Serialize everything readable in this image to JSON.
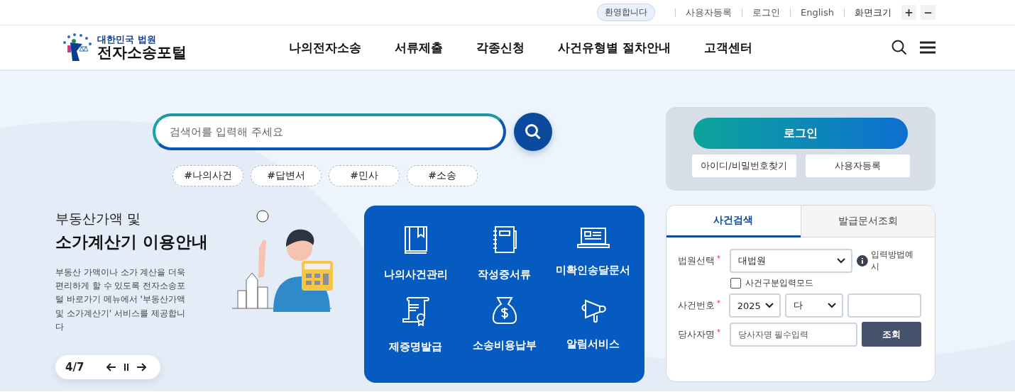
{
  "utility_bar": {
    "welcome": "환영합니다",
    "links": [
      "사용자등록",
      "로그인",
      "English"
    ],
    "font_size_label": "화면크기",
    "font_size_buttons": [
      "+",
      "−"
    ]
  },
  "logo": {
    "subtitle": "대한민국 법원",
    "title": "전자소송포털"
  },
  "nav": {
    "items": [
      "나의전자소송",
      "서류제출",
      "각종신청",
      "사건유형별 절차안내",
      "고객센터"
    ]
  },
  "search": {
    "placeholder": "검색어를 입력해 주세요",
    "tags": [
      "#나의사건",
      "#답변서",
      "#민사",
      "#소송"
    ]
  },
  "promo": {
    "title_line1": "부동산가액 및",
    "title_line2": "소가계산기 이용안내",
    "body": "부동산 가액이나 소가 계산을 더욱 편리하게 할 수 있도록 전자소송포털 바로가기 메뉴에서 '부동산가액 및 소가계산기' 서비스를 제공합니다",
    "pager": "4/7",
    "paused": false
  },
  "quick_menu": {
    "items": [
      "나의사건관리",
      "작성중서류",
      "미확인송달문서",
      "제증명발급",
      "소송비용납부",
      "알림서비스"
    ]
  },
  "login": {
    "button": "로그인",
    "links": [
      "아이디/비밀번호찾기",
      "사용자등록"
    ]
  },
  "case_search": {
    "tabs": [
      {
        "label": "사건검색",
        "selected": true
      },
      {
        "label": "발급문서조회",
        "selected": false
      }
    ],
    "required_mark": "*",
    "court": {
      "label": "법원선택",
      "value": "대법원",
      "help": "입력방법예시"
    },
    "mode_checkbox": {
      "label": "사건구분입력모드",
      "checked": false
    },
    "case_number": {
      "label": "사건번호",
      "year": "2025",
      "type": "다"
    },
    "party": {
      "label": "당사자명",
      "placeholder": "당사자명 필수입력"
    },
    "submit": "조회"
  }
}
